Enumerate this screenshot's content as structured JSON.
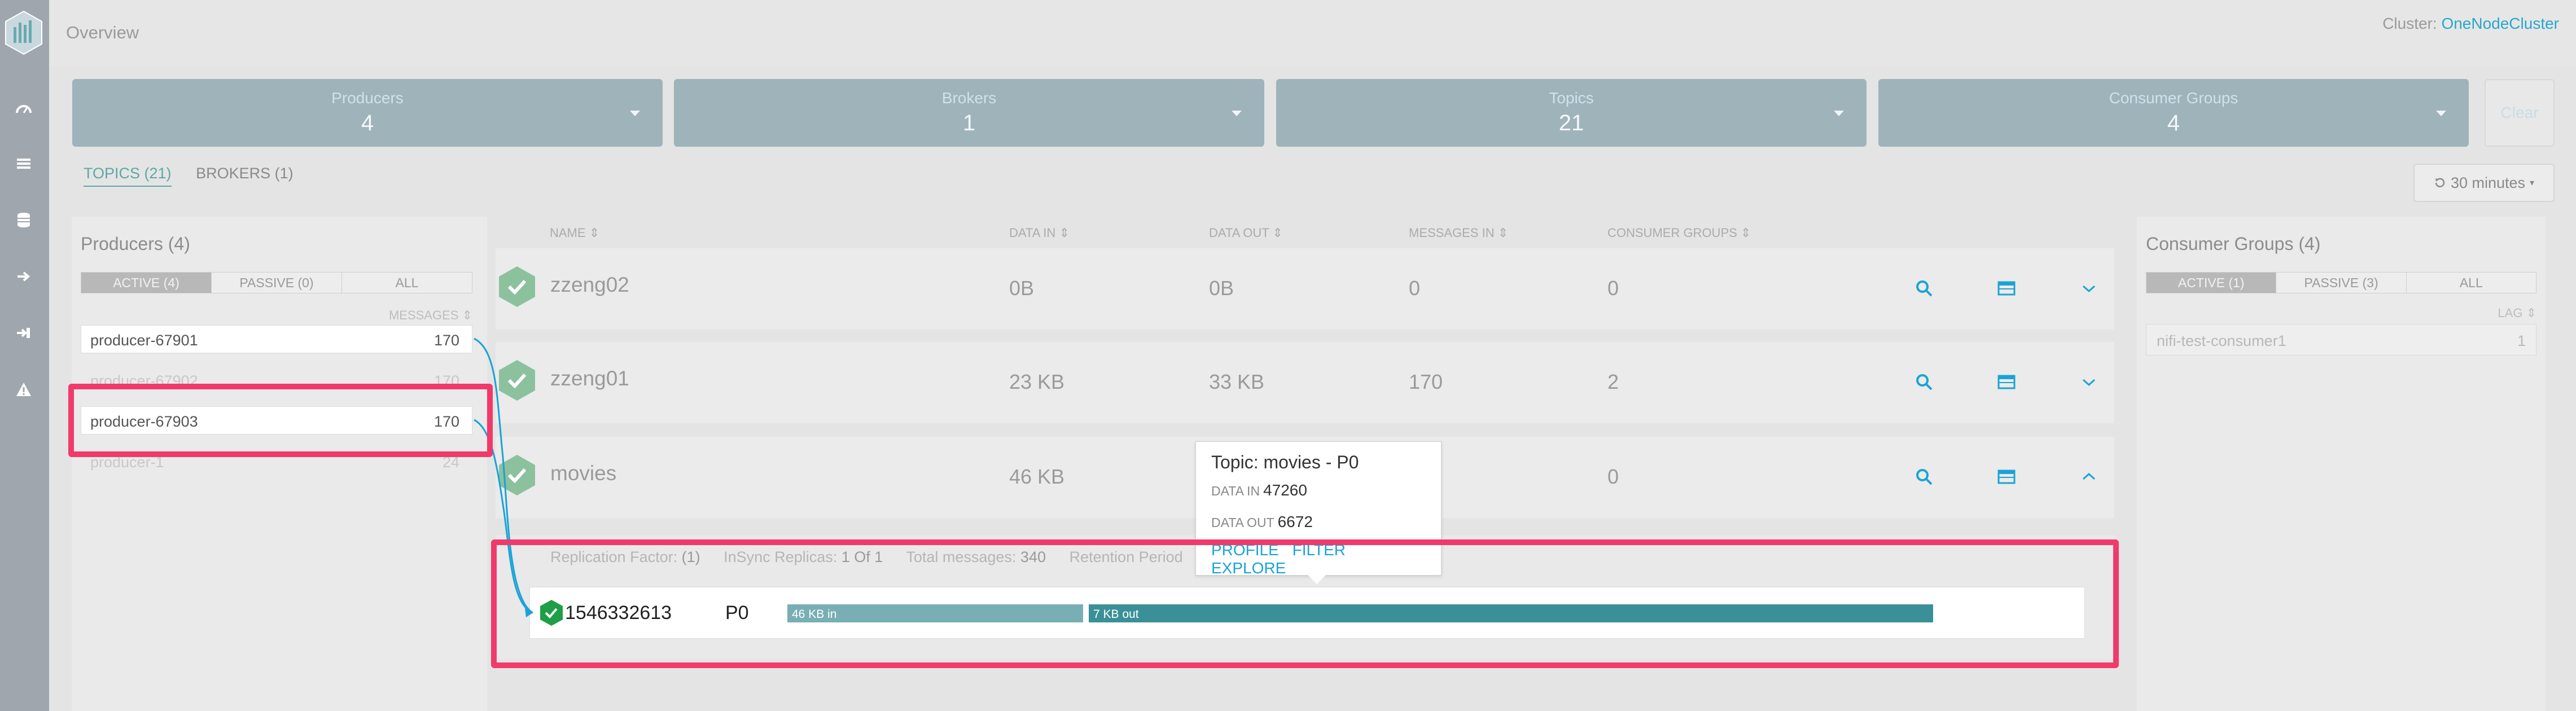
{
  "header": {
    "page_title": "Overview",
    "cluster_label": "Cluster:",
    "cluster_name": "OneNodeCluster"
  },
  "rail": {
    "icons": [
      "dashboard-icon",
      "list-icon",
      "database-icon",
      "sign-out-icon",
      "login-icon",
      "alert-icon"
    ]
  },
  "summary": [
    {
      "label": "Producers",
      "count": "4"
    },
    {
      "label": "Brokers",
      "count": "1"
    },
    {
      "label": "Topics",
      "count": "21"
    },
    {
      "label": "Consumer Groups",
      "count": "4"
    }
  ],
  "clear_label": "Clear",
  "tabs": [
    {
      "label": "TOPICS (21)",
      "active": true
    },
    {
      "label": "BROKERS (1)",
      "active": false
    }
  ],
  "time_range": "30 minutes",
  "producers": {
    "title": "Producers (4)",
    "filters": [
      "ACTIVE (4)",
      "PASSIVE (0)",
      "ALL"
    ],
    "sort_label": "MESSAGES",
    "rows": [
      {
        "name": "producer-67901",
        "value": "170"
      },
      {
        "name": "producer-67902",
        "value": "170"
      },
      {
        "name": "producer-67903",
        "value": "170"
      },
      {
        "name": "producer-1",
        "value": "24"
      }
    ]
  },
  "topics": {
    "columns": [
      "NAME",
      "DATA IN",
      "DATA OUT",
      "MESSAGES IN",
      "CONSUMER GROUPS"
    ],
    "rows": [
      {
        "name": "zzeng02",
        "data_in": "0B",
        "data_out": "0B",
        "messages_in": "0",
        "consumer_groups": "0"
      },
      {
        "name": "zzeng01",
        "data_in": "23 KB",
        "data_out": "33 KB",
        "messages_in": "170",
        "consumer_groups": "2"
      },
      {
        "name": "movies",
        "data_in": "46 KB",
        "data_out": "",
        "messages_in": "",
        "consumer_groups": "0"
      }
    ],
    "details": {
      "replication_label": "Replication Factor:",
      "replication_value": "(1)",
      "insync_label": "InSync Replicas:",
      "insync_value": "1 Of 1",
      "total_label": "Total messages:",
      "total_value": "340",
      "retention_label": "Retention Period"
    },
    "partition": {
      "id": "1546332613",
      "name": "P0",
      "in_label": "46 KB in",
      "out_label": "7 KB out",
      "in_fraction": 0.26,
      "out_fraction": 0.74
    }
  },
  "tooltip": {
    "title": "Topic: movies - P0",
    "data_in_label": "DATA IN",
    "data_in_value": "47260",
    "data_out_label": "DATA OUT",
    "data_out_value": "6672",
    "links": [
      "PROFILE",
      "FILTER",
      "EXPLORE"
    ]
  },
  "consumer_groups": {
    "title": "Consumer Groups (4)",
    "filters": [
      "ACTIVE (1)",
      "PASSIVE (3)",
      "ALL"
    ],
    "sort_label": "LAG",
    "rows": [
      {
        "name": "nifi-test-consumer1",
        "value": "1"
      }
    ]
  },
  "colors": {
    "accent": "#28a7cc",
    "tile": "#9fb3bb",
    "status_ok": "#1e9e47",
    "highlight": "#f03a6a",
    "bar_in": "#78aeb4",
    "bar_out": "#3b9097"
  }
}
